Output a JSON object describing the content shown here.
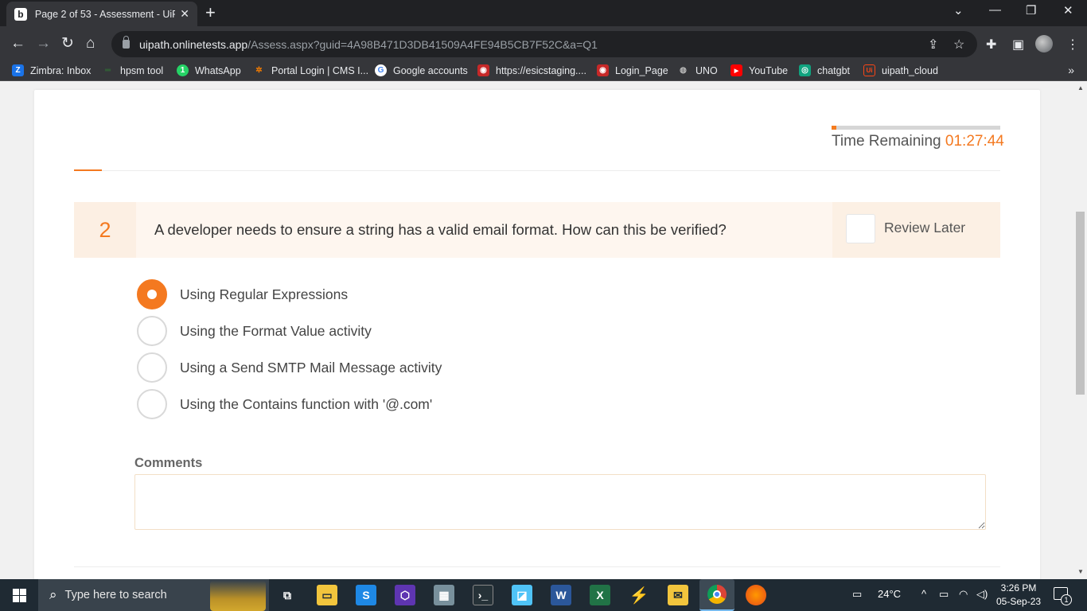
{
  "browser": {
    "tab": {
      "title": "Page 2 of 53 - Assessment - UiPa",
      "favicon": "b",
      "close": "✕"
    },
    "new_tab": "+",
    "window_controls": {
      "tab_search": "⌄",
      "minimize": "—",
      "restore": "❐",
      "close": "✕"
    },
    "nav": {
      "back": "←",
      "forward": "→",
      "reload": "↻",
      "home": "⌂"
    },
    "url_host": "uipath.onlinetests.app",
    "url_path": "/Assess.aspx?guid=4A98B471D3DB41509A4FE94B5CB7F52C&a=Q1",
    "bookmarks": [
      {
        "label": "Zimbra: Inbox",
        "icon": "Z",
        "color": "#1a73e8"
      },
      {
        "label": "hpsm tool",
        "icon": "═",
        "color": "#2e7d32"
      },
      {
        "label": "WhatsApp",
        "icon": "1",
        "color": "#25d366"
      },
      {
        "label": "Portal Login | CMS I...",
        "icon": "✲",
        "color": "#f57c00"
      },
      {
        "label": "Google accounts",
        "icon": "G",
        "color": "#ffffff"
      },
      {
        "label": "https://esicstaging....",
        "icon": "◉",
        "color": "#c62828"
      },
      {
        "label": "Login_Page",
        "icon": "◉",
        "color": "#c62828"
      },
      {
        "label": "UNO",
        "icon": "◍",
        "color": "#9e9e9e"
      },
      {
        "label": "YouTube",
        "icon": "▶",
        "color": "#ff0000"
      },
      {
        "label": "chatgbt",
        "icon": "◎",
        "color": "#10a37f"
      },
      {
        "label": "uipath_cloud",
        "icon": "Ui",
        "color": "#fa4616"
      }
    ],
    "bookmarks_more": "»"
  },
  "assessment": {
    "timer_label": "Time Remaining",
    "timer_value": "01:27:44",
    "timer_progress": 0.03,
    "question_number": "2",
    "question_text": "A developer needs to ensure a string has a valid email format. How can this be verified?",
    "review_later_label": "Review Later",
    "options": [
      {
        "label": "Using Regular Expressions",
        "selected": true
      },
      {
        "label": "Using the Format Value activity",
        "selected": false
      },
      {
        "label": "Using a Send SMTP Mail Message activity",
        "selected": false
      },
      {
        "label": "Using the Contains function with '@.com'",
        "selected": false
      }
    ],
    "comments_label": "Comments",
    "comments_value": ""
  },
  "taskbar": {
    "search_placeholder": "Type here to search",
    "weather": "24°C",
    "time": "3:26 PM",
    "date": "05-Sep-23",
    "notification_count": "1"
  },
  "colors": {
    "accent": "#f47920",
    "question_bg": "#fef6ef",
    "browser_dark": "#202124",
    "taskbar": "#1f2a33"
  }
}
